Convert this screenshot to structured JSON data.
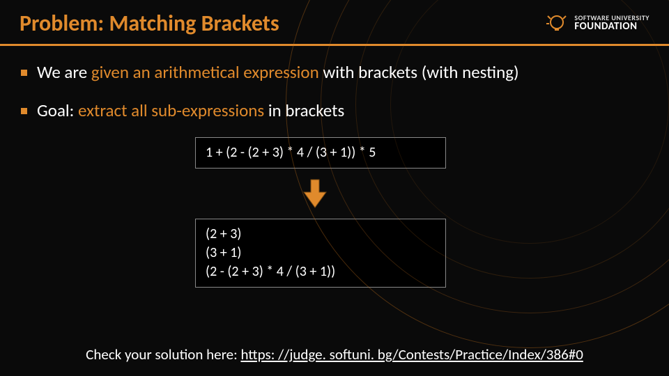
{
  "title": "Problem: Matching Brackets",
  "logo": {
    "top": "SOFTWARE UNIVERSITY",
    "bottom": "FOUNDATION"
  },
  "bullets": [
    {
      "pre": "We are ",
      "hl": "given an arithmetical expression",
      "post": " with brackets (with nesting)"
    },
    {
      "pre": "Goal: ",
      "hl": "extract all sub-expressions",
      "post": " in brackets"
    }
  ],
  "input_box": "1 + (2 - (2 + 3) * 4 / (3 + 1)) * 5",
  "output_lines": [
    "(2 + 3)",
    "(3 + 1)",
    "(2 - (2 + 3) * 4 / (3 + 1))"
  ],
  "footer": {
    "label": "Check your solution here: ",
    "url": "https: //judge. softuni. bg/Contests/Practice/Index/386#0"
  }
}
